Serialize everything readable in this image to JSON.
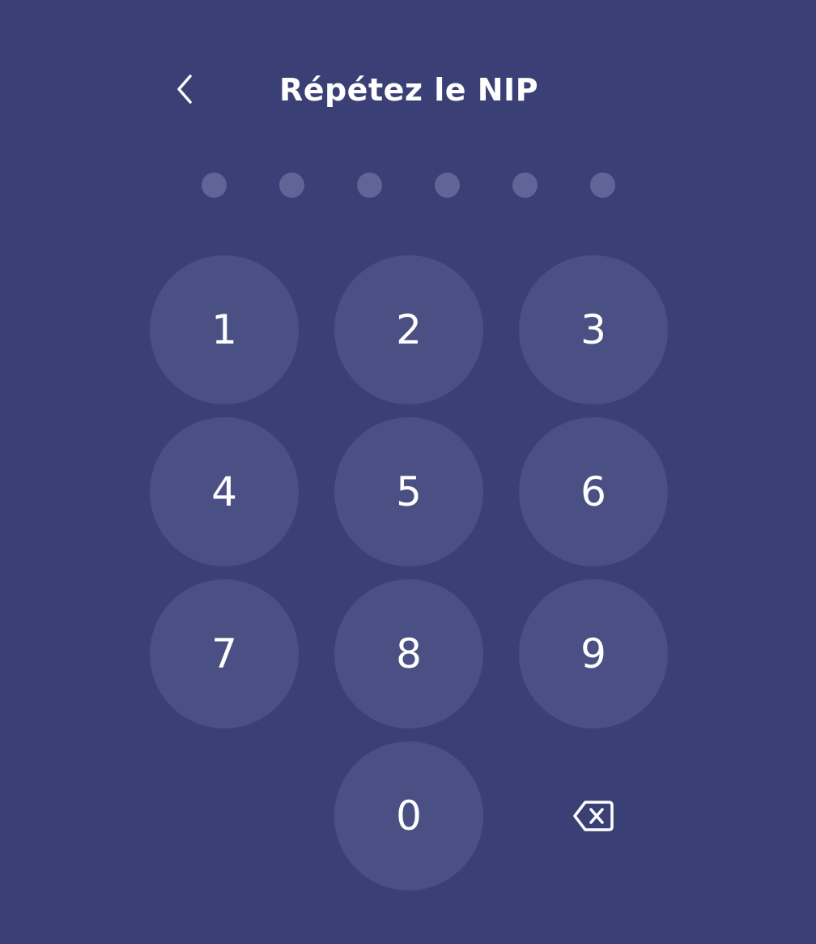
{
  "header": {
    "title": "Répétez le NIP",
    "back_icon": "chevron-left-icon"
  },
  "pin": {
    "length": 6,
    "filled": 0
  },
  "keypad": {
    "keys": [
      "1",
      "2",
      "3",
      "4",
      "5",
      "6",
      "7",
      "8",
      "9",
      "0"
    ],
    "delete_icon": "backspace-icon"
  },
  "colors": {
    "background": "#3a4075",
    "key_fill": "#4a5083",
    "dot_fill": "#5f6596",
    "text": "#ffffff"
  }
}
